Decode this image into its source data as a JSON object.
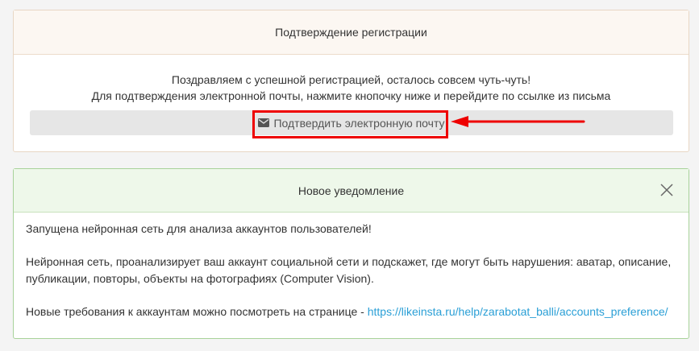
{
  "confirm": {
    "title": "Подтверждение регистрации",
    "line1": "Поздравляем с успешной регистрацией, осталось совсем чуть-чуть!",
    "line2": "Для подтверждения электронной почты, нажмите кнопочку ниже и перейдите по ссылке из письма",
    "button_label": "Подтвердить электронную почту",
    "button_icon": "envelope-icon",
    "highlight_color": "#e00000"
  },
  "notification": {
    "title": "Новое уведомление",
    "close_icon": "close-icon",
    "paragraph1": "Запущена нейронная сеть для анализа аккаунтов пользователей!",
    "paragraph2": "Нейронная сеть, проанализирует ваш аккаунт социальной сети и подскажет, где могут быть нарушения: аватар, описание, публикации, повторы, объекты на фотографиях (Computer Vision).",
    "paragraph3_prefix": "Новые требования к аккаунтам можно посмотреть на странице - ",
    "link": "https://likeinsta.ru/help/zarabotat_balli/accounts_preference/",
    "link_color": "#2a9fd6"
  }
}
